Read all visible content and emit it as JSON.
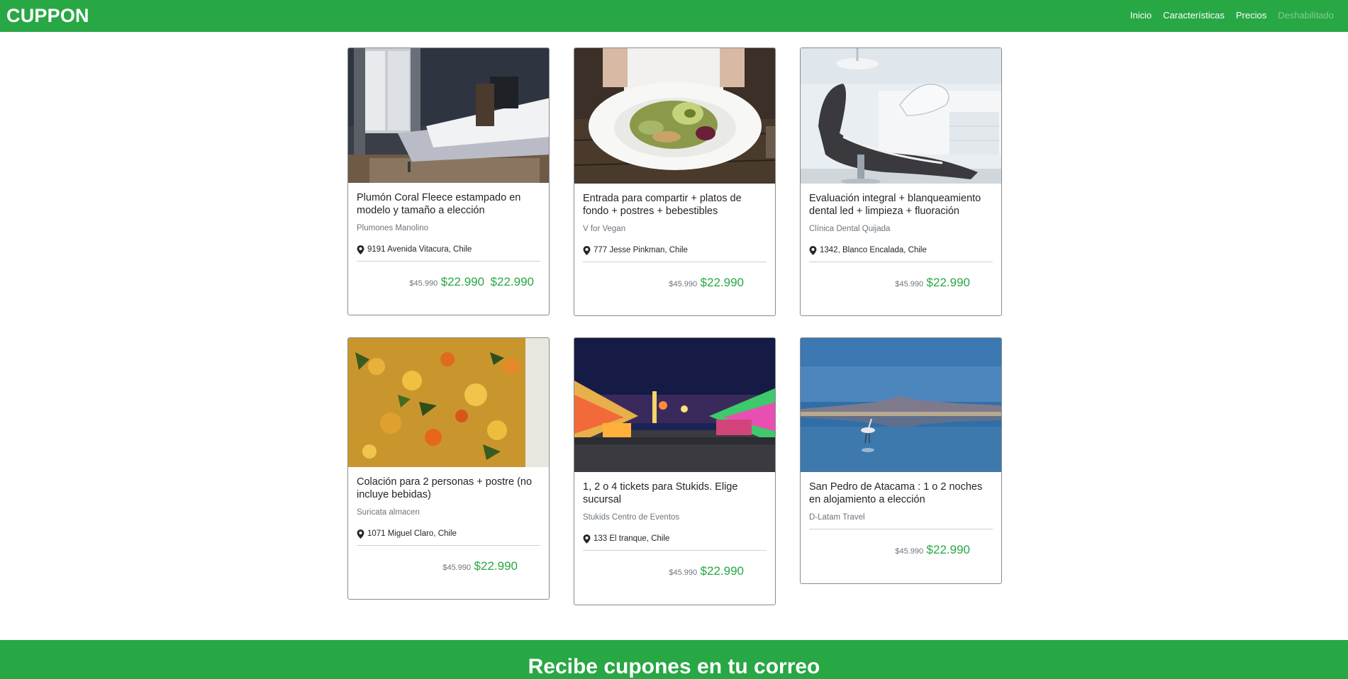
{
  "nav": {
    "brand": "CUPPON",
    "links": [
      "Inicio",
      "Características",
      "Precios",
      "Deshabilitado"
    ]
  },
  "cards": [
    {
      "title": "Plumón Coral Fleece estampado en modelo y tamaño a elección",
      "company": "Plumones Manolino",
      "location": "9191 Avenida Vitacura, Chile",
      "old_price": "$45.990",
      "new_price": "$22.990",
      "extra_price": "$22.990",
      "image": "bedroom-photo"
    },
    {
      "title": "Entrada para compartir + platos de fondo + postres + bebestibles",
      "company": "V for Vegan",
      "location": "777 Jesse Pinkman, Chile",
      "old_price": "$45.990",
      "new_price": "$22.990",
      "image": "vegan-dish-photo"
    },
    {
      "title": "Evaluación integral + blanqueamiento dental led + limpieza + fluoración",
      "company": "Clínica Dental Quijada",
      "location": "1342, Blanco Encalada, Chile",
      "old_price": "$45.990",
      "new_price": "$22.990",
      "image": "dental-chair-photo"
    },
    {
      "title": "Colación para 2 personas + postre (no incluye bebidas)",
      "company": "Suricata almacen",
      "location": "1071 Miguel Claro, Chile",
      "old_price": "$45.990",
      "new_price": "$22.990",
      "image": "stew-photo"
    },
    {
      "title": "1, 2 o 4 tickets para Stukids. Elige sucursal",
      "company": "Stukids Centro de Eventos",
      "location": "133 El tranque, Chile",
      "old_price": "$45.990",
      "new_price": "$22.990",
      "image": "fair-photo"
    },
    {
      "title": "San Pedro de Atacama : 1 o 2 noches en alojamiento a elección",
      "company": "D-Latam Travel",
      "old_price": "$45.990",
      "new_price": "$22.990",
      "image": "lagoon-flamingo-photo"
    }
  ],
  "footer": {
    "title": "Recibe cupones en tu correo"
  },
  "colors": {
    "brand_green": "#28a745",
    "muted_text": "#6c757d"
  }
}
